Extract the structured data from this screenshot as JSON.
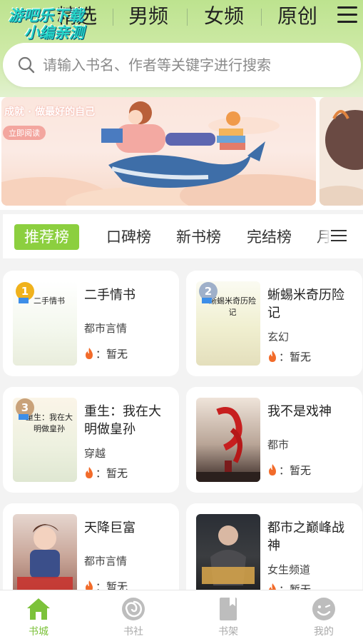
{
  "nav": {
    "tabs": [
      "精选",
      "男频",
      "女频",
      "原创"
    ],
    "menu_icon": "hamburger-menu-icon"
  },
  "watermark": {
    "line1": "游吧乐下载",
    "line2": "小编亲测"
  },
  "search": {
    "placeholder": "请输入书名、作者等关键字进行搜索",
    "icon": "search-icon"
  },
  "banner": {
    "text": "成就 · 做最好的自己",
    "button": "立即阅读"
  },
  "rank_tabs": {
    "items": [
      "推荐榜",
      "口碑榜",
      "新书榜",
      "完结榜",
      "月"
    ],
    "active": "推荐榜"
  },
  "books": [
    {
      "rank": "1",
      "cover_title": "二手情书",
      "title": "二手情书",
      "category": "都市言情",
      "heat": "：暂无"
    },
    {
      "rank": "2",
      "cover_title": "蜥蜴米奇历险记",
      "title": "蜥蜴米奇历险记",
      "category": "玄幻",
      "heat": "：暂无"
    },
    {
      "rank": "3",
      "cover_title": "重生：我在大明做皇孙",
      "title": "重生：我在大明做皇孙",
      "category": "穿越",
      "heat": "：暂无"
    },
    {
      "rank": "",
      "cover_title": "",
      "title": "我不是戏神",
      "category": "都市",
      "heat": "：暂无"
    },
    {
      "rank": "",
      "cover_title": "",
      "title": "天降巨富",
      "category": "都市言情",
      "heat": "：暂无"
    },
    {
      "rank": "",
      "cover_title": "",
      "title": "都市之巅峰战神",
      "category": "女生频道",
      "heat": "：暂无"
    }
  ],
  "bottom_nav": {
    "items": [
      "书城",
      "书社",
      "书架",
      "我的"
    ],
    "active": "书城"
  },
  "colors": {
    "accent": "#8ccf3f",
    "header_green": "#bde38f",
    "rank_gold": "#f0b21c",
    "rank_silver": "#9fb0c9",
    "rank_bronze": "#c9a27a"
  }
}
